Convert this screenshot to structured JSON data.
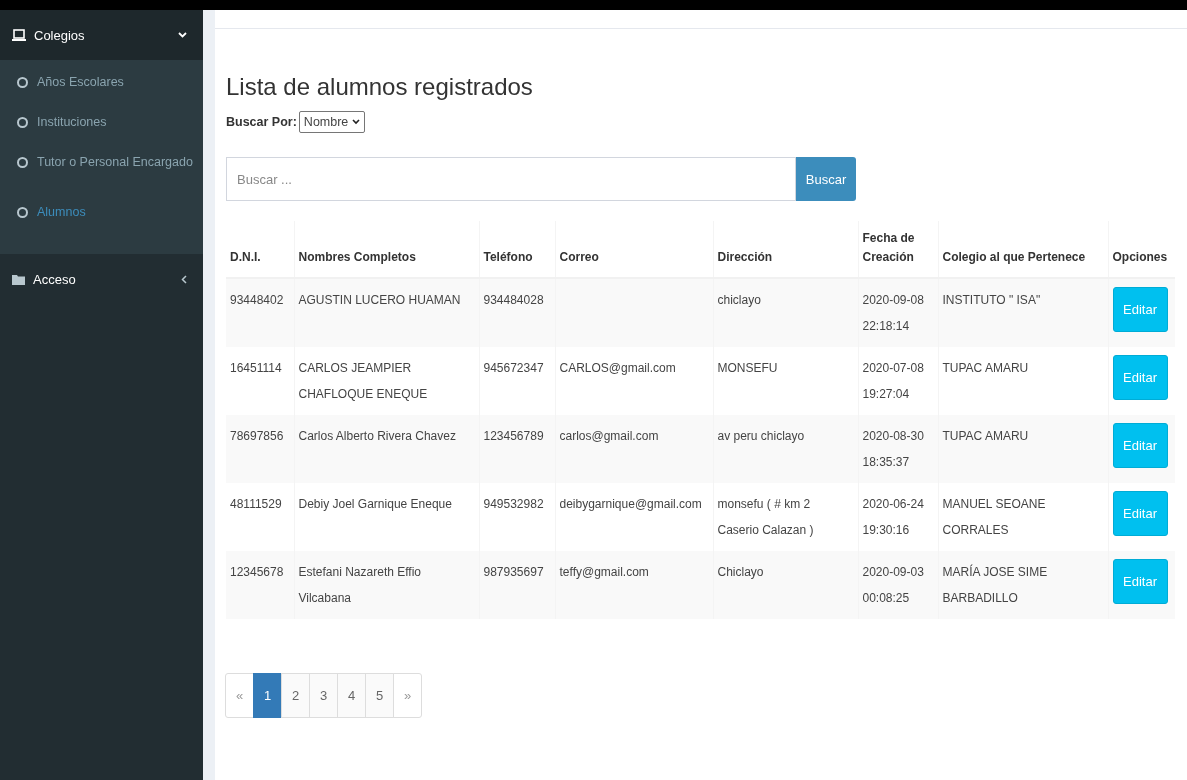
{
  "sidebar": {
    "items": [
      {
        "label": "Colegios",
        "expanded": true,
        "children": [
          {
            "label": "Años Escolares",
            "selected": false
          },
          {
            "label": "Instituciones",
            "selected": false
          },
          {
            "label": "Tutor o Personal Encargado",
            "selected": false
          },
          {
            "label": "Alumnos",
            "selected": true
          }
        ]
      },
      {
        "label": "Acceso",
        "expanded": false
      }
    ]
  },
  "page": {
    "title": "Lista de alumnos registrados",
    "filter": {
      "label": "Buscar Por:",
      "value": "Nombre"
    },
    "search": {
      "placeholder": "Buscar ...",
      "button": "Buscar"
    }
  },
  "table": {
    "columns": [
      "D.N.I.",
      "Nombres Completos",
      "Teléfono",
      "Correo",
      "Dirección",
      "Fecha de Creación",
      "Colegio al que Pertenece",
      "Opciones"
    ],
    "rows": [
      {
        "dni": "93448402",
        "name": "AGUSTIN LUCERO HUAMAN",
        "phone": "934484028",
        "email": "",
        "address": "chiclayo",
        "date": "2020-09-08",
        "time": "22:18:14",
        "school": "INSTITUTO \" ISA\"",
        "action": "Editar"
      },
      {
        "dni": "16451114",
        "name": "CARLOS JEAMPIER CHAFLOQUE ENEQUE",
        "phone": "945672347",
        "email": "CARLOS@gmail.com",
        "address": "MONSEFU",
        "date": "2020-07-08",
        "time": "19:27:04",
        "school": "TUPAC AMARU",
        "action": "Editar"
      },
      {
        "dni": "78697856",
        "name": "Carlos Alberto Rivera Chavez",
        "phone": "123456789",
        "email": "carlos@gmail.com",
        "address": "av peru chiclayo",
        "date": "2020-08-30",
        "time": "18:35:37",
        "school": "TUPAC AMARU",
        "action": "Editar"
      },
      {
        "dni": "48111529",
        "name": "Debiy Joel Garnique Eneque",
        "phone": "949532982",
        "email": "deibygarnique@gmail.com",
        "address": "monsefu ( # km 2 Caserio Calazan )",
        "date": "2020-06-24",
        "time": "19:30:16",
        "school": "MANUEL SEOANE CORRALES",
        "action": "Editar"
      },
      {
        "dni": "12345678",
        "name": "Estefani Nazareth Effio Vilcabana",
        "phone": "987935697",
        "email": "teffy@gmail.com",
        "address": "Chiclayo",
        "date": "2020-09-03",
        "time": "00:08:25",
        "school": "MARÍA JOSE SIME BARBADILLO",
        "action": "Editar"
      }
    ]
  },
  "pagination": {
    "prev": "«",
    "next": "»",
    "pages": [
      {
        "label": "1",
        "selected": true
      },
      {
        "label": "2",
        "selected": false
      },
      {
        "label": "3",
        "selected": false
      },
      {
        "label": "4",
        "selected": false
      },
      {
        "label": "5",
        "selected": false
      }
    ]
  }
}
